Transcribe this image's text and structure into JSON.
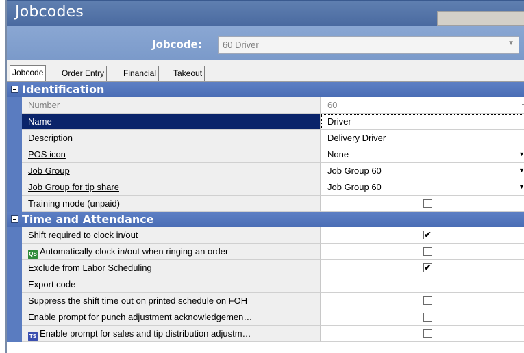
{
  "window": {
    "title": "Jobcodes"
  },
  "jobcode": {
    "label": "Jobcode:",
    "value": "60 Driver"
  },
  "tabs": [
    {
      "label": "Jobcode",
      "active": true
    },
    {
      "label": "Order Entry",
      "active": false
    },
    {
      "label": "Financial",
      "active": false
    },
    {
      "label": "Takeout",
      "active": false
    }
  ],
  "sections": [
    {
      "title": "Identification",
      "rows": [
        {
          "name": "Number",
          "value": "60",
          "kind": "text",
          "disabled": true,
          "ellipsis": true
        },
        {
          "name": "Name",
          "value": "Driver",
          "kind": "text",
          "selected": true
        },
        {
          "name": "Description",
          "value": "Delivery Driver",
          "kind": "text"
        },
        {
          "name": "POS icon",
          "value": "None",
          "kind": "dropdown",
          "link": true
        },
        {
          "name": "Job Group",
          "value": "Job Group 60",
          "kind": "dropdown",
          "link": true
        },
        {
          "name": "Job Group for tip share",
          "value": "Job Group 60",
          "kind": "dropdown",
          "link": true
        },
        {
          "name": "Training mode (unpaid)",
          "value": "",
          "kind": "checkbox",
          "checked": false
        }
      ]
    },
    {
      "title": "Time and Attendance",
      "rows": [
        {
          "name": "Shift required to clock in/out",
          "value": "",
          "kind": "checkbox",
          "checked": true
        },
        {
          "name": "Automatically clock in/out when ringing an order",
          "value": "",
          "kind": "checkbox",
          "checked": false,
          "icon": "QS"
        },
        {
          "name": "Exclude from Labor Scheduling",
          "value": "",
          "kind": "checkbox",
          "checked": true
        },
        {
          "name": "Export code",
          "value": "",
          "kind": "text"
        },
        {
          "name": "Suppress the shift time out on printed schedule on FOH",
          "value": "",
          "kind": "checkbox",
          "checked": false
        },
        {
          "name": "Enable prompt for punch adjustment acknowledgemen…",
          "value": "",
          "kind": "checkbox",
          "checked": false
        },
        {
          "name": "Enable prompt for sales and tip distribution adjustm…",
          "value": "",
          "kind": "checkbox",
          "checked": false,
          "icon": "TS"
        }
      ]
    }
  ],
  "glyphs": {
    "check": "✔",
    "dropdown": "▼",
    "ellipsis": "···"
  }
}
